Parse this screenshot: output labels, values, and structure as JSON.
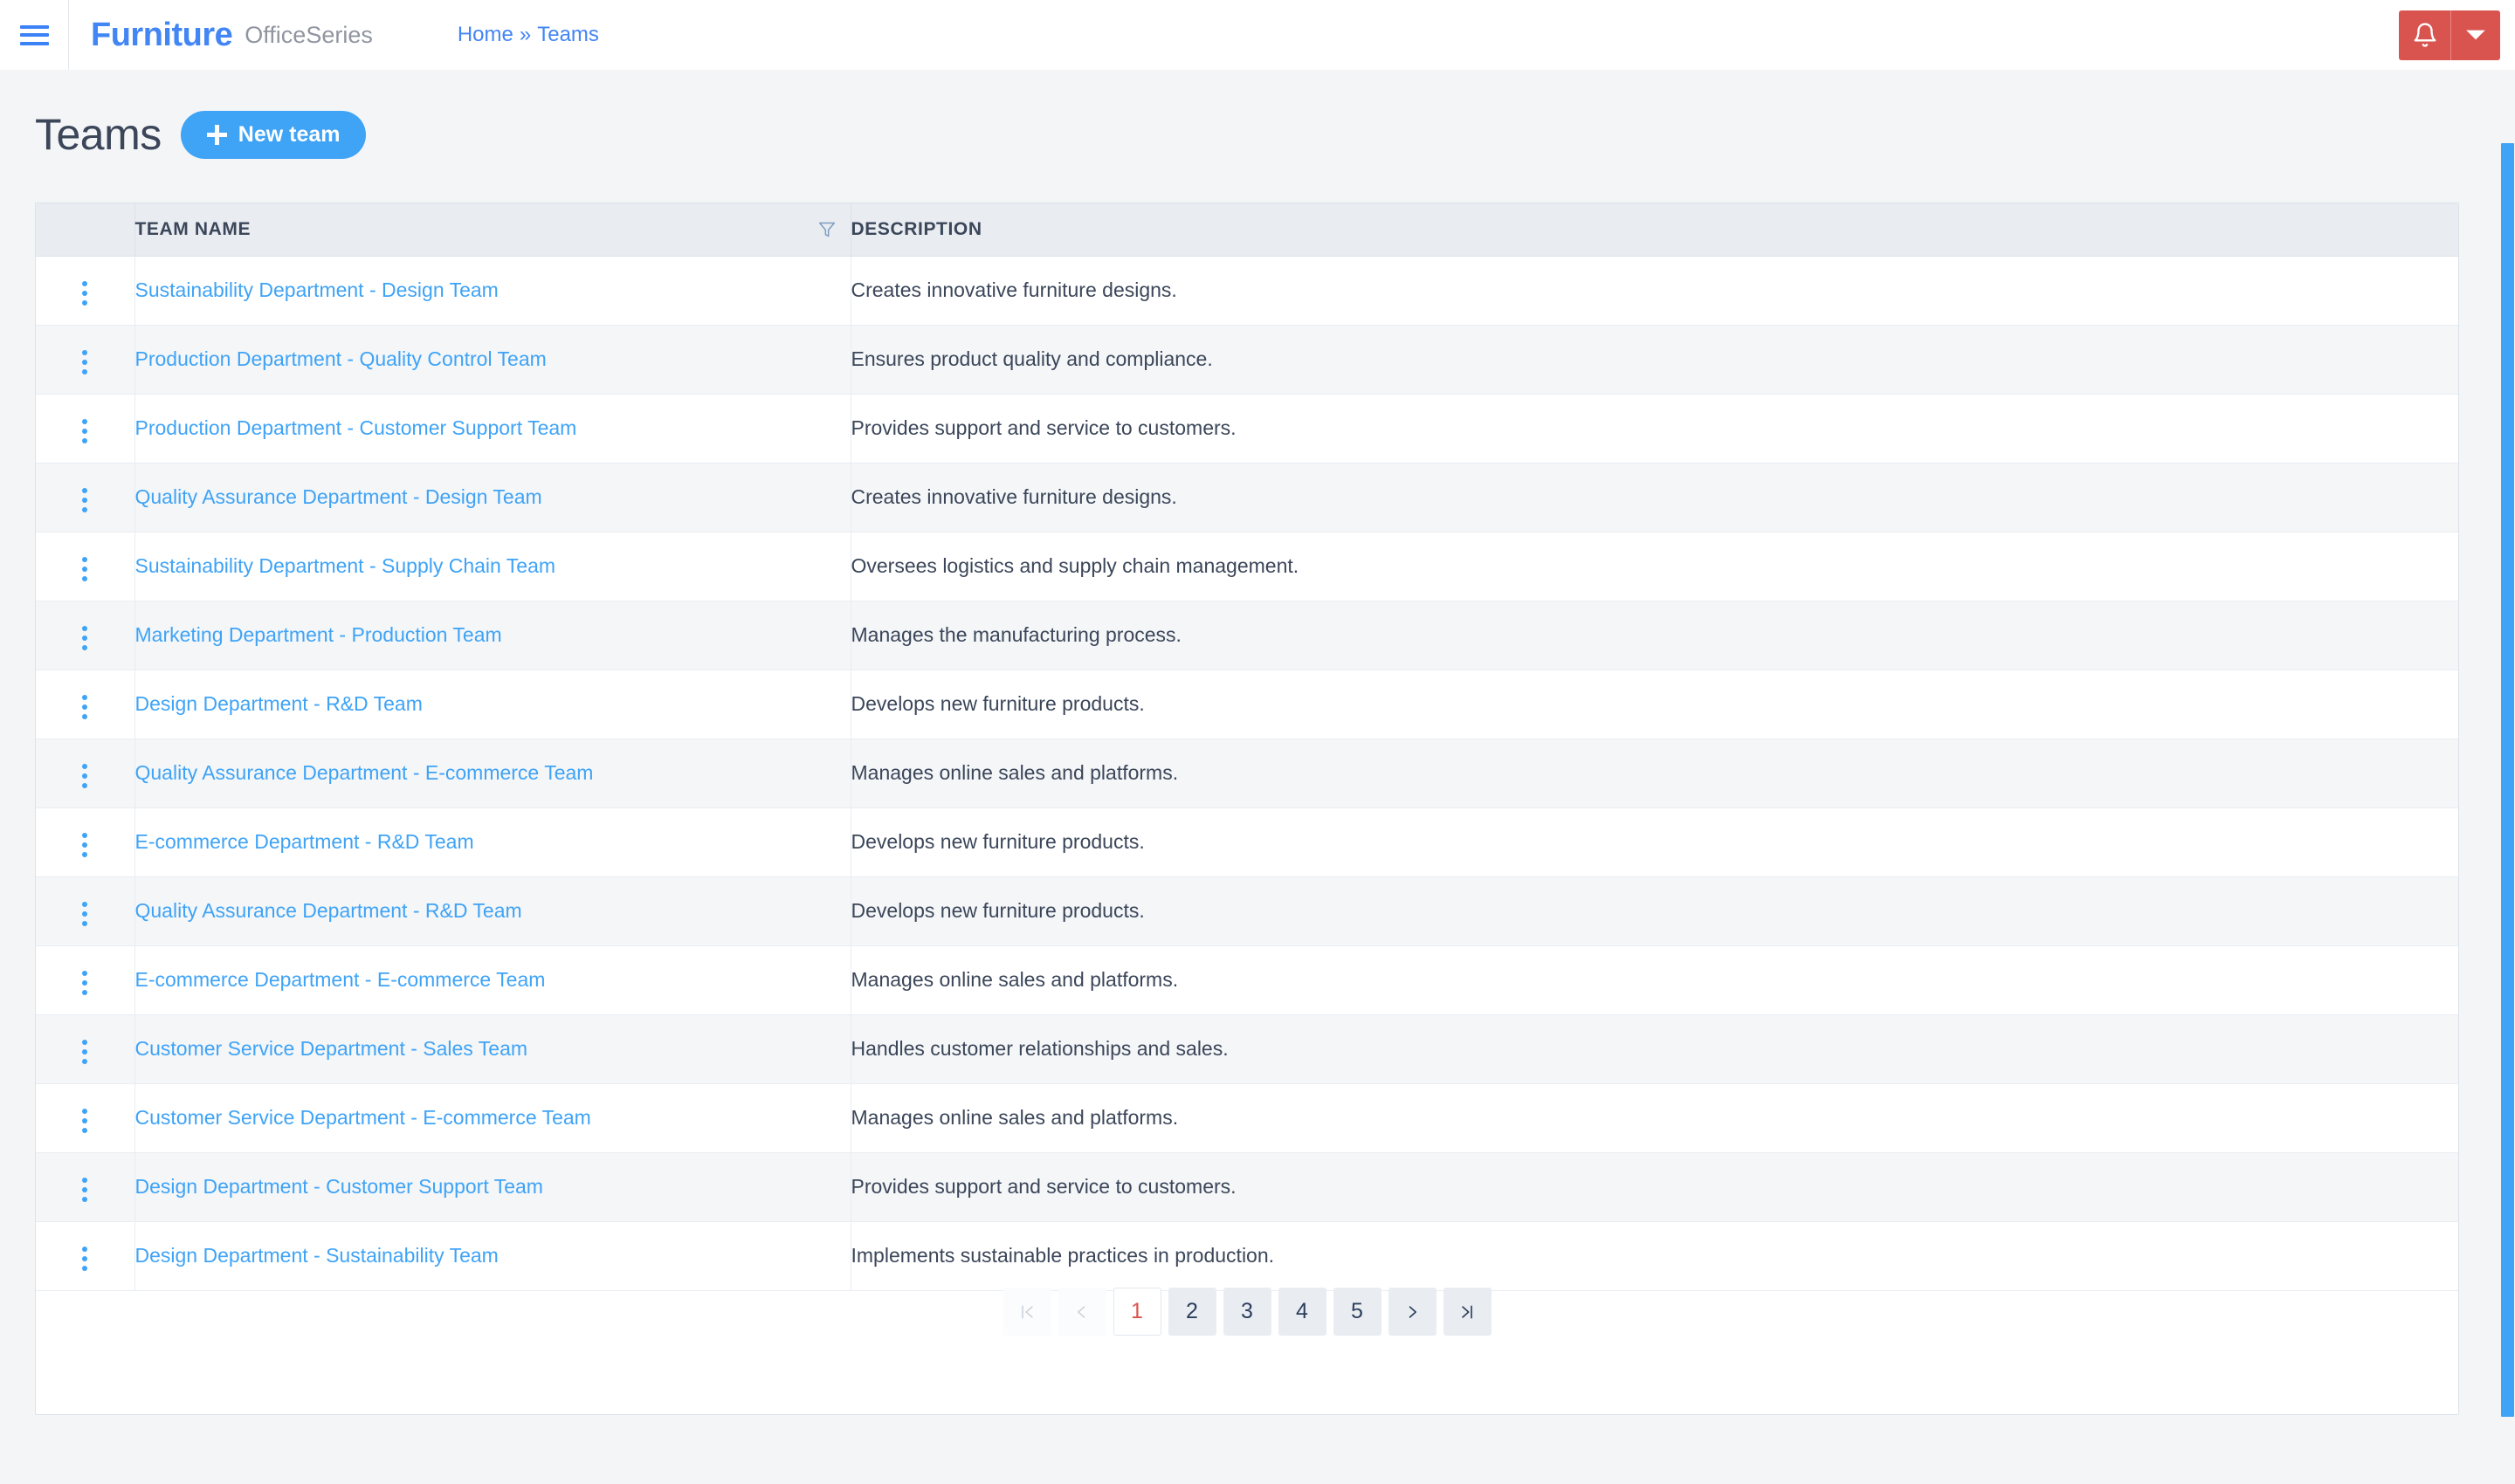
{
  "topbar": {
    "menu_icon": "hamburger-icon",
    "brand_main": "Furniture",
    "brand_sub": "OfficeSeries",
    "breadcrumb": {
      "home": "Home",
      "separator": "»",
      "current": "Teams"
    },
    "notification_icon": "bell-icon",
    "notification_caret_icon": "caret-down-icon",
    "notification_color": "#d9534f"
  },
  "page": {
    "title": "Teams",
    "new_button_label": "New team",
    "new_button_icon": "plus-icon",
    "accent_color": "#3fa3f6"
  },
  "table": {
    "columns": {
      "menu": "",
      "name": "TEAM NAME",
      "description": "DESCRIPTION"
    },
    "filter_icon": "funnel-filter-icon",
    "row_menu_icon": "vertical-ellipsis-icon",
    "rows": [
      {
        "name": "Sustainability Department - Design Team",
        "description": "Creates innovative furniture designs."
      },
      {
        "name": "Production Department - Quality Control Team",
        "description": "Ensures product quality and compliance."
      },
      {
        "name": "Production Department - Customer Support Team",
        "description": "Provides support and service to customers."
      },
      {
        "name": "Quality Assurance Department - Design Team",
        "description": "Creates innovative furniture designs."
      },
      {
        "name": "Sustainability Department - Supply Chain Team",
        "description": "Oversees logistics and supply chain management."
      },
      {
        "name": "Marketing Department - Production Team",
        "description": "Manages the manufacturing process."
      },
      {
        "name": "Design Department - R&D Team",
        "description": "Develops new furniture products."
      },
      {
        "name": "Quality Assurance Department - E-commerce Team",
        "description": "Manages online sales and platforms."
      },
      {
        "name": "E-commerce Department - R&D Team",
        "description": "Develops new furniture products."
      },
      {
        "name": "Quality Assurance Department - R&D Team",
        "description": "Develops new furniture products."
      },
      {
        "name": "E-commerce Department - E-commerce Team",
        "description": "Manages online sales and platforms."
      },
      {
        "name": "Customer Service Department - Sales Team",
        "description": "Handles customer relationships and sales."
      },
      {
        "name": "Customer Service Department - E-commerce Team",
        "description": "Manages online sales and platforms."
      },
      {
        "name": "Design Department - Customer Support Team",
        "description": "Provides support and service to customers."
      },
      {
        "name": "Design Department - Sustainability Team",
        "description": "Implements sustainable practices in production."
      }
    ]
  },
  "pagination": {
    "first_label": "|<",
    "prev_label": "<",
    "next_label": ">",
    "last_label": ">|",
    "pages": [
      "1",
      "2",
      "3",
      "4",
      "5"
    ],
    "current_page": "1",
    "active_color": "#d9534f"
  }
}
